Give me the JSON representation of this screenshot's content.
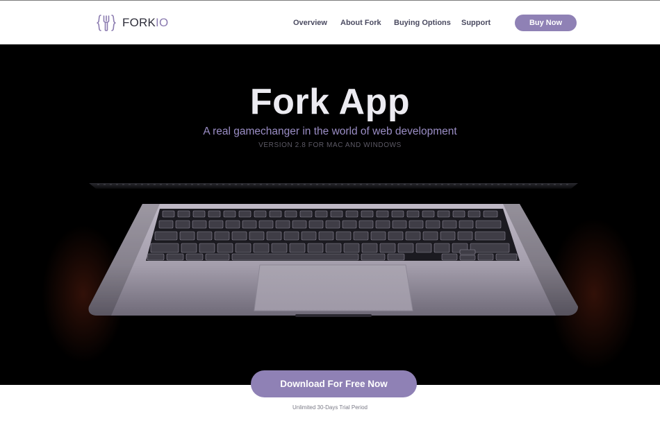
{
  "brand": {
    "name_part1": "FORK",
    "name_part2": "IO",
    "logo_icon": "fork-brackets-logo-icon"
  },
  "nav": {
    "items": [
      {
        "label": "Overview"
      },
      {
        "label": "About Fork"
      },
      {
        "label": "Buying Options"
      },
      {
        "label": "Support"
      }
    ],
    "cta_label": "Buy Now"
  },
  "hero": {
    "title": "Fork App",
    "subtitle": "A real gamechanger in the world of web development",
    "version": "VERSION 2.8 FOR MAC AND WINDOWS",
    "image": "laptop-keyboard-image"
  },
  "download": {
    "button_label": "Download For Free Now",
    "note": "Unlimited 30-Days Trial Period"
  },
  "colors": {
    "accent": "#8f81b5",
    "hero_background": "#000000",
    "title": "#ecebf1",
    "subtitle": "#9b8ec6"
  }
}
